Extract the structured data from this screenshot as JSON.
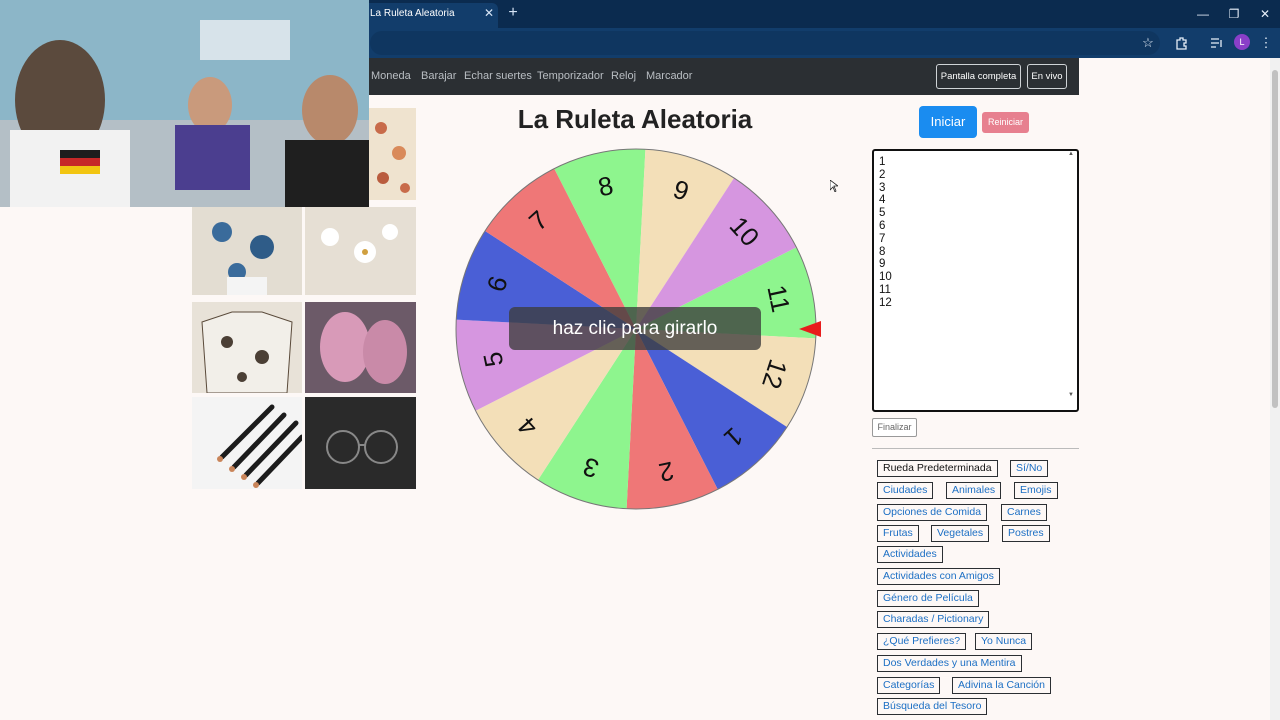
{
  "browser": {
    "tab_title": "La Ruleta Aleatoria",
    "tab_close": "✕",
    "new_tab": "+",
    "profile_letter": "L",
    "window_controls": [
      "—",
      "❐",
      "✕"
    ]
  },
  "nav": {
    "links": [
      "Moneda",
      "Barajar",
      "Echar suertes",
      "Temporizador",
      "Reloj",
      "Marcador"
    ],
    "fullscreen": "Pantalla completa",
    "live": "En vivo"
  },
  "main": {
    "title": "La Ruleta Aleatoria",
    "start": "Iniciar",
    "reset": "Reiniciar",
    "spin_hint": "haz clic para girarlo",
    "finish": "Finalizar"
  },
  "entries": [
    "1",
    "2",
    "3",
    "4",
    "5",
    "6",
    "7",
    "8",
    "9",
    "10",
    "11",
    "12"
  ],
  "wheel": {
    "segments": [
      {
        "label": "11",
        "color": "#8ef58e"
      },
      {
        "label": "12",
        "color": "#f3dfb8"
      },
      {
        "label": "1",
        "color": "#4a5fd6"
      },
      {
        "label": "2",
        "color": "#ef7777"
      },
      {
        "label": "3",
        "color": "#8ef58e"
      },
      {
        "label": "4",
        "color": "#f3dfb8"
      },
      {
        "label": "5",
        "color": "#d696e0"
      },
      {
        "label": "6",
        "color": "#4a5fd6"
      },
      {
        "label": "7",
        "color": "#ef7777"
      },
      {
        "label": "8",
        "color": "#8ef58e"
      },
      {
        "label": "9",
        "color": "#f3dfb8"
      },
      {
        "label": "10",
        "color": "#d696e0"
      }
    ],
    "pointer_color": "#e81c1c"
  },
  "presets": [
    {
      "label": "Rueda Predeterminada",
      "dark": true
    },
    {
      "label": "Sí/No"
    },
    {
      "label": "Ciudades"
    },
    {
      "label": "Animales"
    },
    {
      "label": "Emojis"
    },
    {
      "label": "Opciones de Comida"
    },
    {
      "label": "Carnes"
    },
    {
      "label": "Frutas"
    },
    {
      "label": "Vegetales"
    },
    {
      "label": "Postres"
    },
    {
      "label": "Actividades"
    },
    {
      "label": "Actividades con Amigos"
    },
    {
      "label": "Género de Película"
    },
    {
      "label": "Charadas / Pictionary"
    },
    {
      "label": "¿Qué Prefieres?"
    },
    {
      "label": "Yo Nunca"
    },
    {
      "label": "Dos Verdades y una Mentira"
    },
    {
      "label": "Categorías"
    },
    {
      "label": "Adivina la Canción"
    },
    {
      "label": "Búsqueda del Tesoro"
    }
  ]
}
